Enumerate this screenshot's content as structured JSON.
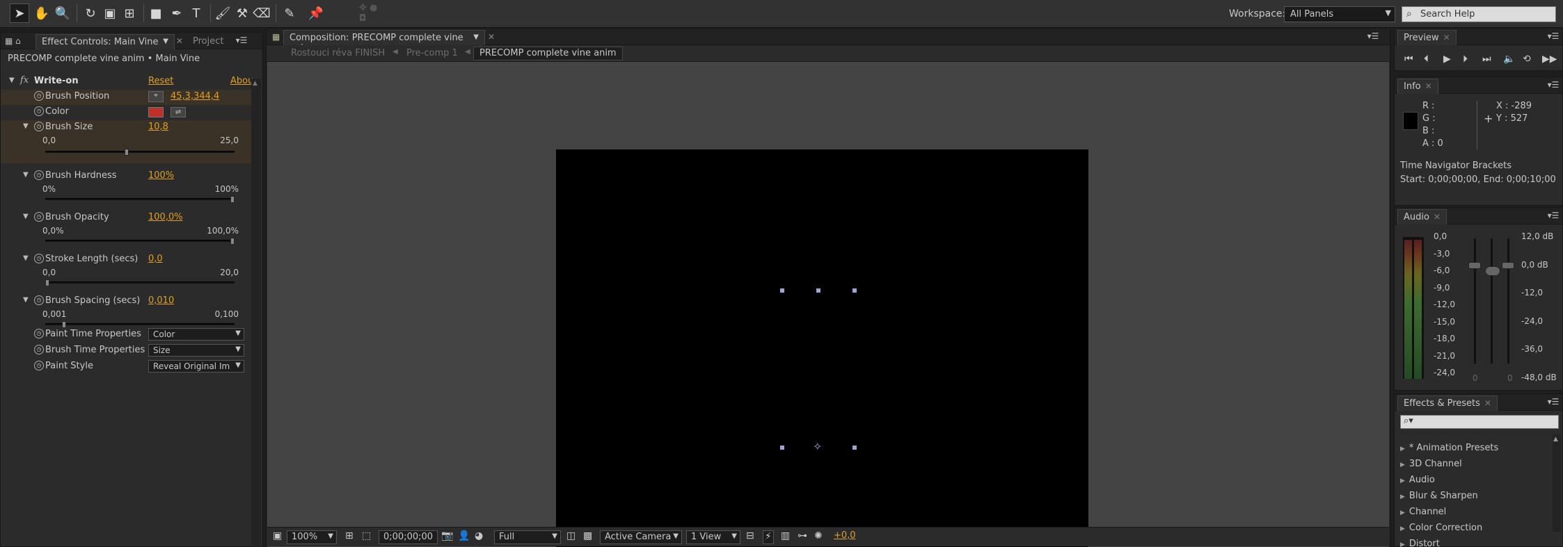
{
  "workspace": {
    "label": "Workspace:",
    "value": "All Panels",
    "search_placeholder": "Search Help"
  },
  "effect_controls": {
    "tab_label": "Effect Controls: Main Vine",
    "tab2_label": "Project",
    "subtitle": "PRECOMP complete vine anim • Main Vine",
    "effect_name": "Write-on",
    "reset_label": "Reset",
    "about_label": "Abou",
    "properties": [
      {
        "label": "Brush Position",
        "value": "45,3,344,4"
      },
      {
        "label": "Color",
        "value": ""
      },
      {
        "label": "Brush Size",
        "value": "10,8",
        "min": "0,0",
        "max": "25,0",
        "fraction": 0.43
      },
      {
        "label": "Brush Hardness",
        "value": "100%",
        "min": "0%",
        "max": "100%",
        "fraction": 1.0
      },
      {
        "label": "Brush Opacity",
        "value": "100,0%",
        "min": "0,0%",
        "max": "100,0%",
        "fraction": 1.0
      },
      {
        "label": "Stroke Length (secs)",
        "value": "0,0",
        "min": "0,0",
        "max": "20,0",
        "fraction": 0.0
      },
      {
        "label": "Brush Spacing (secs)",
        "value": "0,010",
        "min": "0,001",
        "max": "0,100",
        "fraction": 0.09
      },
      {
        "label": "Paint Time Properties",
        "value": "Color"
      },
      {
        "label": "Brush Time Properties",
        "value": "Size"
      },
      {
        "label": "Paint Style",
        "value": "Reveal Original Im"
      }
    ],
    "color_swatch": "#c0302b"
  },
  "composition": {
    "tab_label": "Composition: PRECOMP complete vine anim",
    "breadcrumbs": [
      "Rostouci réva FINISH",
      "Pre-comp 1",
      "PRECOMP complete vine anim"
    ],
    "zoom": "100%",
    "timecode": "0;00;00;00",
    "resolution": "Full",
    "camera": "Active Camera",
    "views": "1 View",
    "exposure": "+0,0"
  },
  "preview": {
    "tab_label": "Preview"
  },
  "info": {
    "tab_label": "Info",
    "r": "R :",
    "g": "G :",
    "b": "B :",
    "a": "A : 0",
    "x": "X : -289",
    "y": "Y : 527",
    "nav_title": "Time Navigator Brackets",
    "nav_range": "Start: 0;00;00;00, End: 0;00;10;00"
  },
  "audio": {
    "tab_label": "Audio",
    "left_scale": [
      "0,0",
      "-3,0",
      "-6,0",
      "-9,0",
      "-12,0",
      "-15,0",
      "-18,0",
      "-21,0",
      "-24,0"
    ],
    "right_scale": [
      "12,0 dB",
      "0,0 dB",
      "-12,0",
      "-24,0",
      "-36,0",
      "-48,0 dB"
    ],
    "fader_left": "0",
    "fader_right": "0"
  },
  "effects_presets": {
    "tab_label": "Effects & Presets",
    "search_placeholder": "",
    "items": [
      "* Animation Presets",
      "3D Channel",
      "Audio",
      "Blur & Sharpen",
      "Channel",
      "Color Correction",
      "Distort"
    ]
  }
}
